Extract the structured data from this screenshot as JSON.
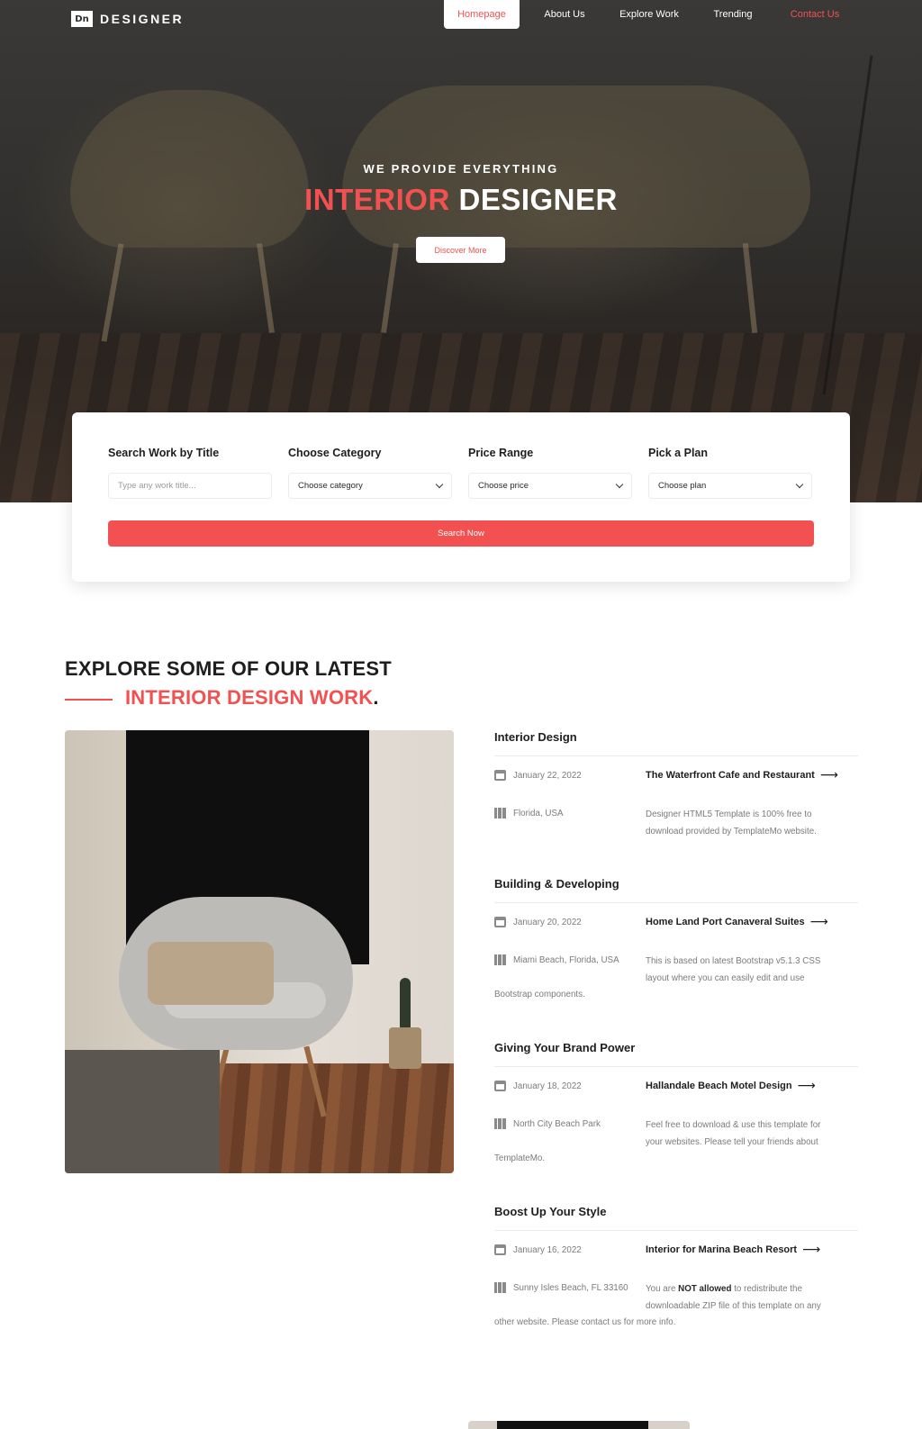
{
  "brand": {
    "logo_mark": "Dn",
    "name": "DESIGNER"
  },
  "nav": [
    {
      "label": "Homepage",
      "active": true
    },
    {
      "label": "About Us"
    },
    {
      "label": "Explore Work"
    },
    {
      "label": "Trending"
    },
    {
      "label": "Contact Us"
    }
  ],
  "hero": {
    "subtitle": "WE PROVIDE EVERYTHING",
    "title_accent": "INTERIOR",
    "title_rest": "DESIGNER",
    "cta": "Discover More"
  },
  "search": {
    "fields": [
      {
        "label": "Search Work by Title",
        "placeholder": "Type any work title..."
      },
      {
        "label": "Choose Category",
        "value": "Choose category"
      },
      {
        "label": "Price Range",
        "value": "Choose price"
      },
      {
        "label": "Pick a Plan",
        "value": "Choose plan"
      }
    ],
    "button": "Search Now"
  },
  "section": {
    "heading_line1": "EXPLORE SOME OF OUR LATEST",
    "heading_line2": "INTERIOR DESIGN WORK",
    "heading_dot": "."
  },
  "works": [
    {
      "category": "Interior Design",
      "date": "January 22, 2022",
      "location": "Florida, USA",
      "title": "The Waterfront Cafe and Restaurant",
      "desc": [
        "Designer HTML5 Template is 100% free to",
        "download provided by TemplateMo website."
      ]
    },
    {
      "category": "Building & Developing",
      "date": "January 20, 2022",
      "location": "Miami Beach, Florida, USA",
      "title": "Home Land Port Canaveral Suites",
      "desc": [
        "This is based on latest Bootstrap v5.1.3 CSS",
        "layout where you can easily edit and use"
      ],
      "desc_tail": "Bootstrap components."
    },
    {
      "category": "Giving Your Brand Power",
      "date": "January 18, 2022",
      "location": "North City Beach Park",
      "title": "Hallandale Beach Motel Design",
      "desc": [
        "Feel free to download & use this template for",
        "your websites. Please tell your friends about"
      ],
      "desc_tail": "TemplateMo."
    },
    {
      "category": "Boost Up Your Style",
      "date": "January 16, 2022",
      "location": "Sunny Isles Beach, FL 33160",
      "title": "Interior for Marina Beach Resort",
      "desc_pre": "You are ",
      "desc_bold": "NOT allowed",
      "desc_post": " to redistribute the",
      "desc": [
        "",
        "downloadable ZIP file of this template on any"
      ],
      "desc_tail": "other website. Please contact us for more info."
    }
  ],
  "colors": {
    "accent": "#f35151",
    "dark": "#1e1e1e",
    "muted": "#7b7b7b"
  },
  "icons": {
    "date": "calendar-icon",
    "location": "map-icon",
    "link": "arrow-right-icon"
  }
}
